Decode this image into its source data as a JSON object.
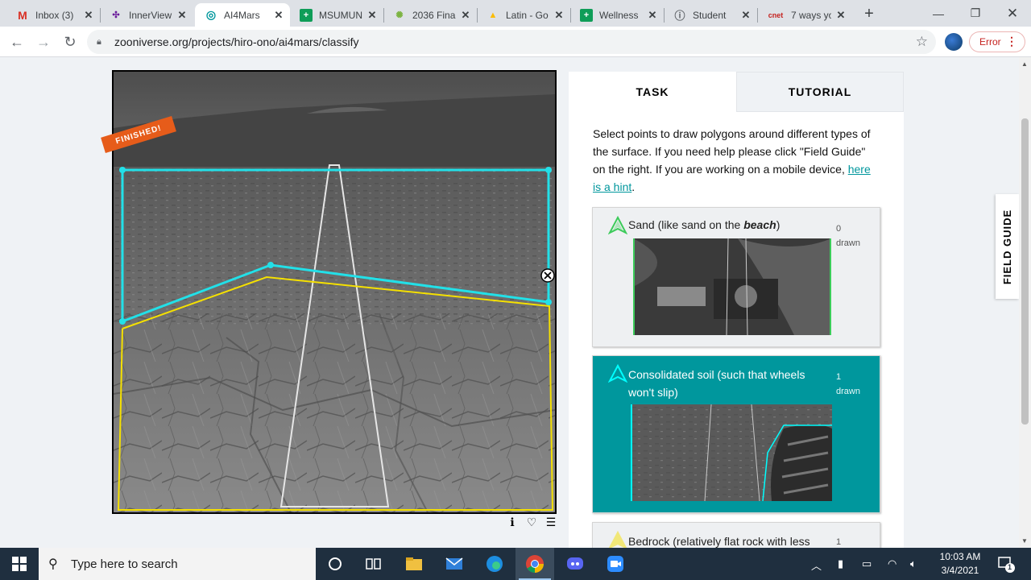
{
  "browser": {
    "tabs": [
      {
        "title": "Inbox (3)",
        "icon": "gmail-icon",
        "color": "#d93025",
        "active": false
      },
      {
        "title": "InnerView",
        "icon": "innerview-icon",
        "color": "#6a1b9a",
        "active": false
      },
      {
        "title": "AI4Mars",
        "icon": "zooniverse-icon",
        "color": "#00979d",
        "active": true
      },
      {
        "title": "MSUMUN",
        "icon": "sheets-icon",
        "color": "#0f9d58",
        "active": false
      },
      {
        "title": "2036 Fina",
        "icon": "globe-icon",
        "color": "#7cb342",
        "active": false
      },
      {
        "title": "Latin - Go",
        "icon": "drive-icon",
        "color": "#fbbc04",
        "active": false
      },
      {
        "title": "Wellness",
        "icon": "sheets-icon",
        "color": "#0f9d58",
        "active": false
      },
      {
        "title": "Student",
        "icon": "info-icon",
        "color": "#5f6368",
        "active": false
      },
      {
        "title": "7 ways yo",
        "icon": "cnet-icon",
        "color": "#c5221f",
        "active": false
      }
    ],
    "url": "zooniverse.org/projects/hiro-ono/ai4mars/classify",
    "error_label": "Error"
  },
  "subject": {
    "badge": "FINISHED!"
  },
  "task_panel": {
    "tabs": {
      "task": "TASK",
      "tutorial": "TUTORIAL"
    },
    "instructions_before": "Select points to draw polygons around different types of the surface. If you need help please click \"Field Guide\" on the right. If you are working on a mobile device, ",
    "hint_link": "here is a hint",
    "instructions_after": ".",
    "choices": [
      {
        "label_pre": "Sand (like sand on the ",
        "label_em": "beach",
        "label_post": ")",
        "count": "0",
        "count_label": "drawn",
        "color": "#3ccb5a",
        "selected": false
      },
      {
        "label": "Consolidated soil (such that wheels won't slip)",
        "count": "1",
        "count_label": "drawn",
        "color": "#00ffff",
        "selected": true
      },
      {
        "label": "Bedrock (relatively flat rock with less",
        "count": "1",
        "count_label": "",
        "color": "#f5e000",
        "selected": false
      }
    ],
    "field_guide": "FIELD GUIDE"
  },
  "taskbar": {
    "search_placeholder": "Type here to search",
    "time": "10:03 AM",
    "date": "3/4/2021",
    "notifications": "1"
  }
}
